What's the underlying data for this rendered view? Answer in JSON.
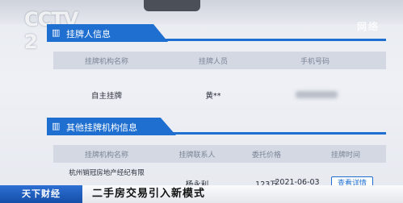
{
  "broadcast": {
    "logo": "CCTV 2",
    "corner_watermark": "网络"
  },
  "section1": {
    "icon": "building-icon",
    "title": "挂牌人信息",
    "columns": [
      "挂牌机构名称",
      "挂牌人员",
      "手机号码"
    ],
    "row": {
      "agency": "自主挂牌",
      "person": "黄**",
      "phone": ""
    }
  },
  "section2": {
    "icon": "building-icon",
    "title": "其他挂牌机构信息",
    "columns": [
      "挂牌机构名称",
      "挂牌联系人",
      "委托价格",
      "挂牌时间"
    ],
    "row": {
      "agency": "杭州销冠房地产经纪有限",
      "contact": "杨永利",
      "price": "123万",
      "date": "2021-06-03",
      "action": "查看详情"
    }
  },
  "ticker": {
    "channel": "天下财经",
    "headline": "二手房交易引入新模式"
  },
  "colors": {
    "accent": "#1f6fd1",
    "header_bg": "#d3d8e2"
  }
}
